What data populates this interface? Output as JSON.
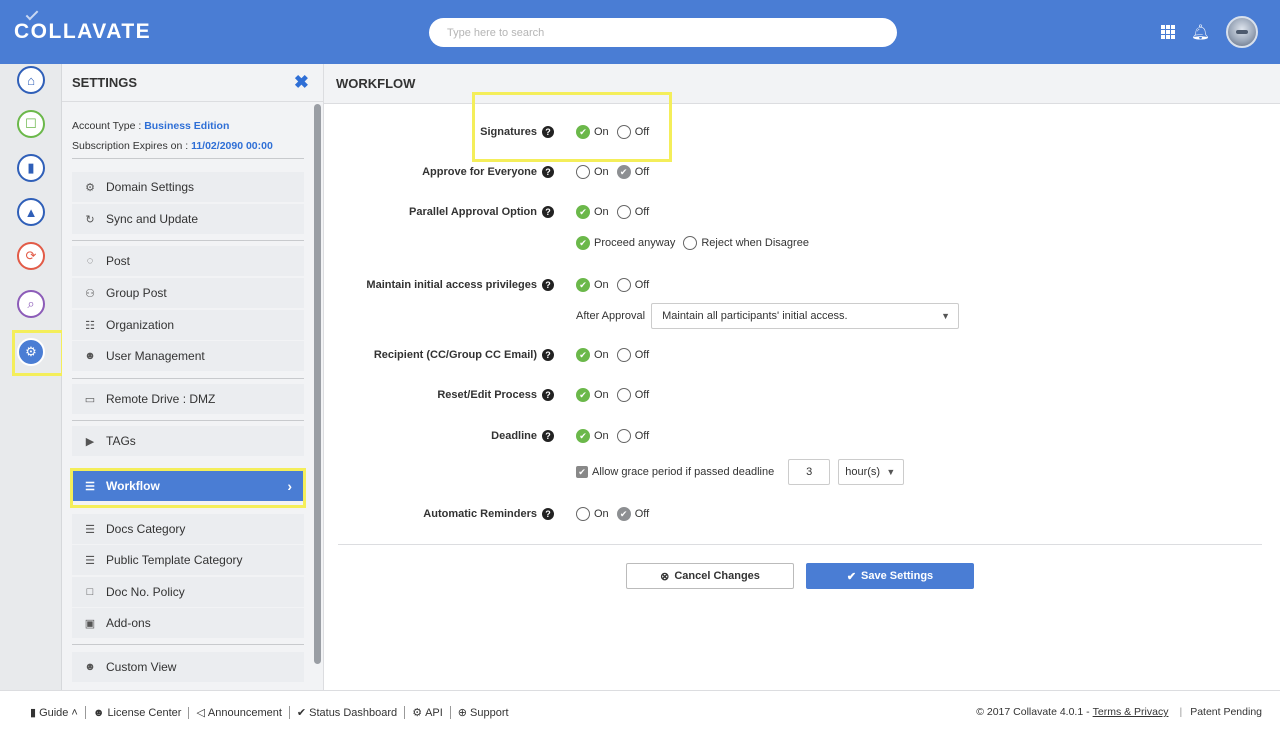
{
  "app": {
    "logo": "COLLAVATE"
  },
  "search": {
    "placeholder": "Type here to search"
  },
  "sidebar": {
    "title": "SETTINGS",
    "account_type_label": "Account Type :",
    "account_type_value": "Business Edition",
    "subscription_label": "Subscription Expires on :",
    "subscription_value": "11/02/2090 00:00",
    "items": [
      {
        "label": "Domain Settings",
        "icon": "gear-icon"
      },
      {
        "label": "Sync and Update",
        "icon": "sync-icon"
      },
      {
        "label": "Post",
        "icon": "post-icon"
      },
      {
        "label": "Group Post",
        "icon": "group-icon"
      },
      {
        "label": "Organization",
        "icon": "org-chart-icon"
      },
      {
        "label": "User Management",
        "icon": "user-icon"
      },
      {
        "label": "Remote Drive : DMZ",
        "icon": "drive-icon"
      },
      {
        "label": "TAGs",
        "icon": "tag-icon"
      },
      {
        "label": "Workflow",
        "icon": "workflow-icon"
      },
      {
        "label": "Docs Category",
        "icon": "doc-icon"
      },
      {
        "label": "Public Template Category",
        "icon": "doc-icon"
      },
      {
        "label": "Doc No. Policy",
        "icon": "doc-outline-icon"
      },
      {
        "label": "Add-ons",
        "icon": "lock-icon"
      },
      {
        "label": "Custom View",
        "icon": "user-icon"
      }
    ]
  },
  "main": {
    "title": "WORKFLOW",
    "on_label": "On",
    "off_label": "Off",
    "settings": [
      {
        "label": "Signatures",
        "value": "On"
      },
      {
        "label": "Approve for Everyone",
        "value": "Off"
      },
      {
        "label": "Parallel Approval Option",
        "value": "On"
      },
      {
        "label": "Maintain initial access privileges",
        "value": "On"
      },
      {
        "label": "Recipient (CC/Group CC Email)",
        "value": "On"
      },
      {
        "label": "Reset/Edit Process",
        "value": "On"
      },
      {
        "label": "Deadline",
        "value": "On"
      },
      {
        "label": "Automatic Reminders",
        "value": "Off"
      }
    ],
    "parallel_sub": {
      "proceed_label": "Proceed anyway",
      "reject_label": "Reject when Disagree",
      "selected": "Proceed anyway"
    },
    "after_approval": {
      "label": "After Approval",
      "value": "Maintain all participants' initial access."
    },
    "grace": {
      "label": "Allow grace period if passed deadline",
      "checked": true,
      "amount": "3",
      "unit": "hour(s)"
    },
    "cancel_label": "Cancel Changes",
    "save_label": "Save Settings"
  },
  "footer": {
    "guide": "Guide",
    "license": "License Center",
    "announcement": "Announcement",
    "status": "Status Dashboard",
    "api": "API",
    "support": "Support",
    "copyright": "© 2017 Collavate 4.0.1 -",
    "terms": "Terms & Privacy",
    "patent": "Patent Pending"
  },
  "colors": {
    "brand": "#4a7dd4",
    "on": "#6bb84a",
    "highlight": "#f4ee5a"
  }
}
